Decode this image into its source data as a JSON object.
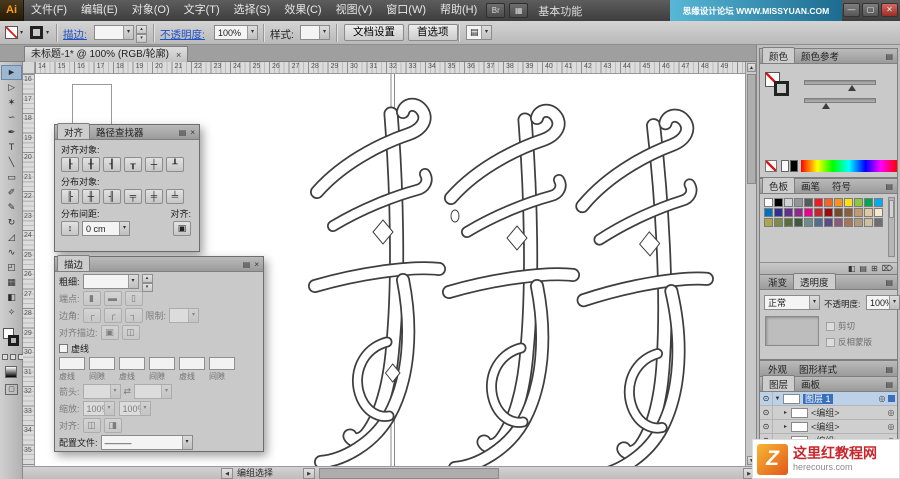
{
  "window": {
    "app_label": "Ai",
    "menus": [
      "文件(F)",
      "编辑(E)",
      "对象(O)",
      "文字(T)",
      "选择(S)",
      "效果(C)",
      "视图(V)",
      "窗口(W)",
      "帮助(H)"
    ],
    "bridge_button": "Br",
    "arrange_button": "▦",
    "workspace": "基本功能",
    "brand": "思缘设计论坛 WWW.MISSYUAN.COM",
    "minimize": "—",
    "maximize": "▢",
    "close": "✕"
  },
  "control_bar": {
    "stroke_link": "描边:",
    "opacity_link": "不透明度:",
    "opacity_value": "100%",
    "style_label": "样式:",
    "doc_setup_button": "文档设置",
    "preferences_button": "首选项"
  },
  "doc_tab": {
    "title": "未标题-1* @ 100% (RGB/轮廓)",
    "close": "×"
  },
  "tools": [
    {
      "name": "selection",
      "glyph": "►"
    },
    {
      "name": "direct-selection",
      "glyph": "▷"
    },
    {
      "name": "magic-wand",
      "glyph": "✶"
    },
    {
      "name": "lasso",
      "glyph": "∽"
    },
    {
      "name": "pen",
      "glyph": "✒"
    },
    {
      "name": "type",
      "glyph": "T"
    },
    {
      "name": "line-segment",
      "glyph": "╲"
    },
    {
      "name": "rectangle",
      "glyph": "▭"
    },
    {
      "name": "paintbrush",
      "glyph": "✐"
    },
    {
      "name": "pencil",
      "glyph": "✎"
    },
    {
      "name": "rotate",
      "glyph": "↻"
    },
    {
      "name": "scale",
      "glyph": "◿"
    },
    {
      "name": "width",
      "glyph": "∿"
    },
    {
      "name": "free-transform",
      "glyph": "◰"
    },
    {
      "name": "mesh",
      "glyph": "▦"
    },
    {
      "name": "gradient",
      "glyph": "◧"
    },
    {
      "name": "eyedropper",
      "glyph": "✧"
    }
  ],
  "rulers": {
    "top": [
      14,
      15,
      16,
      17,
      18,
      19,
      20,
      21,
      22,
      23,
      24,
      25,
      26,
      27,
      28,
      29,
      30,
      31,
      32,
      33,
      34,
      35,
      36,
      37,
      38,
      39,
      40,
      41,
      42,
      43,
      44,
      45,
      46,
      47,
      48,
      49
    ],
    "left": [
      16,
      17,
      18,
      19,
      20,
      21,
      22,
      23,
      24,
      25,
      26,
      27,
      28,
      29,
      30,
      31,
      32,
      33,
      34,
      35
    ]
  },
  "align_panel": {
    "tabs": [
      "对齐",
      "路径查找器"
    ],
    "align_objects_label": "对齐对象:",
    "align_icons": [
      "┠",
      "╂",
      "┨",
      "┰",
      "┼",
      "┸"
    ],
    "distribute_label": "分布对象:",
    "distribute_icons": [
      "╟",
      "╫",
      "╢",
      "╤",
      "╪",
      "╧"
    ],
    "spacing_label": "分布间距:",
    "align_to_label": "对齐:",
    "spacing_stepper_icon": "↕",
    "spacing_value": "0 cm",
    "align_to_icon": "▣"
  },
  "stroke_panel": {
    "tab": "描边",
    "weight_label": "粗细:",
    "weight_value": "",
    "caps_label": "端点:",
    "caps_icons": [
      "▮",
      "▬",
      "▯"
    ],
    "corner_label": "边角:",
    "corner_icons": [
      "┌",
      "╭",
      "┐"
    ],
    "limit_label": "限制:",
    "limit_value": "",
    "align_stroke_label": "对齐描边:",
    "align_stroke_icons": [
      "▣",
      "◫"
    ],
    "dash_label": "虚线",
    "dash_sublabels": [
      "虚线",
      "间隙",
      "虚线",
      "间隙",
      "虚线",
      "间隙"
    ],
    "arrows_label": "箭头:",
    "swap_icon": "⇄",
    "scale_label": "缩放:",
    "scale_values": [
      "100%",
      "100%"
    ],
    "align_label": "对齐:",
    "align_icons": [
      "◫",
      "◨"
    ],
    "profile_label": "配置文件:",
    "profile_value": "———"
  },
  "color_panel": {
    "tabs": [
      "颜色",
      "颜色参考"
    ]
  },
  "swatches_panel": {
    "tabs": [
      "色板",
      "画笔",
      "符号"
    ],
    "colors": [
      "#ffffff",
      "#000000",
      "#d1d3d4",
      "#939598",
      "#58595b",
      "#ed1c24",
      "#f26522",
      "#f7941d",
      "#ffde17",
      "#8dc63f",
      "#00a651",
      "#00aeef",
      "#0072bc",
      "#2e3192",
      "#662d91",
      "#92278f",
      "#ec008c",
      "#c1272d",
      "#9e0b0f",
      "#754c29",
      "#8b5e3c",
      "#c49a6c",
      "#e3c89e",
      "#f6e9cb",
      "#a9a84c",
      "#7c8a4d",
      "#5b6e3a",
      "#3c5a3c",
      "#6b8e8a",
      "#4f6f8f",
      "#5b4a8a",
      "#8a5a7a",
      "#a8755a",
      "#b09a7a",
      "#cfc0a0",
      "#6d6e71"
    ],
    "footer_icons": [
      "◧",
      "▤",
      "⊞",
      "⌦"
    ]
  },
  "transparency_panel": {
    "tabs": [
      "渐变",
      "透明度"
    ],
    "blend_mode": "正常",
    "opacity_label": "不透明度:",
    "opacity_value": "100%",
    "clip_label": "剪切",
    "invert_label": "反相蒙版"
  },
  "appearance_tabs": [
    "外观",
    "图形样式"
  ],
  "layers_panel": {
    "tabs": [
      "图层",
      "画板"
    ],
    "rows": [
      {
        "label": "图层 1",
        "selected": true,
        "child": false
      },
      {
        "label": "<编组>",
        "selected": false,
        "child": true
      },
      {
        "label": "<编组>",
        "selected": false,
        "child": true
      },
      {
        "label": "<编组>",
        "selected": false,
        "child": true
      }
    ],
    "footer_icons": [
      "◧",
      "⊞",
      "⌦"
    ]
  },
  "status_bar": {
    "tool": "编组选择"
  },
  "watermark": {
    "logo": "Z",
    "title": "这里红教程网",
    "url": "herecours.com"
  },
  "icons": {
    "dropdown": "▾",
    "spin_up": "▴",
    "spin_down": "▾",
    "eye": "⊙",
    "target": "◎",
    "twisty_open": "▼",
    "twisty_closed": "▸",
    "panel_menu": "▤",
    "close": "×",
    "left_arrow": "◀",
    "right_arrow": "▶",
    "up_arrow": "▲",
    "down_arrow": "▼"
  }
}
